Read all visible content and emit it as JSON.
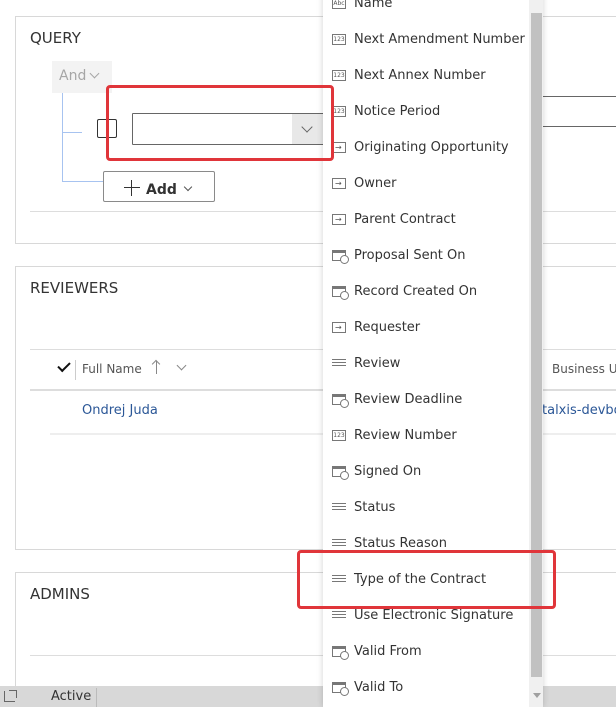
{
  "query": {
    "title": "QUERY",
    "group_operator": "And",
    "condition": {
      "field_value": "",
      "checked": false
    },
    "add_label": "Add"
  },
  "reviewers": {
    "title": "REVIEWERS",
    "columns": [
      "Full Name",
      "Business Unit"
    ],
    "sort": {
      "column": "Full Name",
      "direction": "ascending"
    },
    "rows": [
      {
        "full_name": "Ondrej Juda",
        "business_unit": "talxis-devbo"
      }
    ]
  },
  "admins": {
    "title": "ADMINS"
  },
  "statusbar": {
    "status": "Active"
  },
  "field_dropdown": {
    "highlighted": "Type of the Contract",
    "items": [
      {
        "label": "Name",
        "icon": "text-field-icon"
      },
      {
        "label": "Next Amendment Number",
        "icon": "number-field-icon"
      },
      {
        "label": "Next Annex Number",
        "icon": "number-field-icon"
      },
      {
        "label": "Notice Period",
        "icon": "number-field-icon"
      },
      {
        "label": "Originating Opportunity",
        "icon": "lookup-field-icon"
      },
      {
        "label": "Owner",
        "icon": "lookup-field-icon"
      },
      {
        "label": "Parent Contract",
        "icon": "lookup-field-icon"
      },
      {
        "label": "Proposal Sent On",
        "icon": "date-field-icon"
      },
      {
        "label": "Record Created On",
        "icon": "date-field-icon"
      },
      {
        "label": "Requester",
        "icon": "lookup-field-icon"
      },
      {
        "label": "Review",
        "icon": "option-set-icon"
      },
      {
        "label": "Review Deadline",
        "icon": "date-field-icon"
      },
      {
        "label": "Review Number",
        "icon": "number-field-icon"
      },
      {
        "label": "Signed On",
        "icon": "date-field-icon"
      },
      {
        "label": "Status",
        "icon": "option-set-icon"
      },
      {
        "label": "Status Reason",
        "icon": "option-set-icon"
      },
      {
        "label": "Type of the Contract",
        "icon": "option-set-icon"
      },
      {
        "label": "Use Electronic Signature",
        "icon": "option-set-icon"
      },
      {
        "label": "Valid From",
        "icon": "date-field-icon"
      },
      {
        "label": "Valid To",
        "icon": "date-field-icon"
      }
    ],
    "icon_text": {
      "text-field-icon": "Abc",
      "number-field-icon": "123"
    }
  },
  "colors": {
    "highlight": "#e0353a",
    "link": "#2b5797",
    "tree_line": "#a7c3f0"
  }
}
